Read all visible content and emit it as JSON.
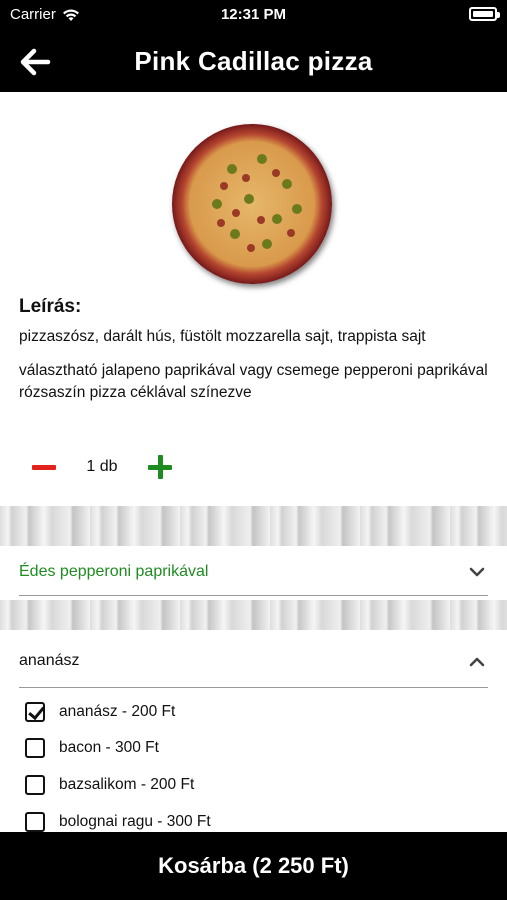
{
  "status": {
    "carrier": "Carrier",
    "time": "12:31 PM",
    "icons": [
      "wifi-icon",
      "battery-icon"
    ]
  },
  "nav": {
    "back_icon": "arrow-left-icon",
    "title": "Pink Cadillac pizza"
  },
  "product": {
    "image": "pizza-image"
  },
  "description": {
    "heading": "Leírás:",
    "line1": "pizzaszósz, darált hús, füstölt mozzarella sajt, trappista sajt",
    "line2": "választható jalapeno paprikával vagy csemege pepperoni paprikával",
    "line3": "rózsaszín pizza céklával színezve"
  },
  "quantity": {
    "value": "1 db",
    "minus_icon": "minus-icon",
    "plus_icon": "plus-icon"
  },
  "variant_select": {
    "selected": "Édes pepperoni paprikával",
    "icon": "chevron-down-icon"
  },
  "extras": {
    "header": "ananász",
    "icon": "chevron-up-icon",
    "options": [
      {
        "label": "ananász - 200 Ft",
        "checked": true
      },
      {
        "label": "bacon - 300 Ft",
        "checked": false
      },
      {
        "label": "bazsalikom - 200 Ft",
        "checked": false
      },
      {
        "label": "bolognai ragu - 300 Ft",
        "checked": false
      }
    ]
  },
  "cart_button": {
    "label": "Kosárba (2 250 Ft)"
  },
  "colors": {
    "accent_green": "#1f8c21",
    "minus_red": "#e3211c",
    "bar_black": "#000000"
  }
}
